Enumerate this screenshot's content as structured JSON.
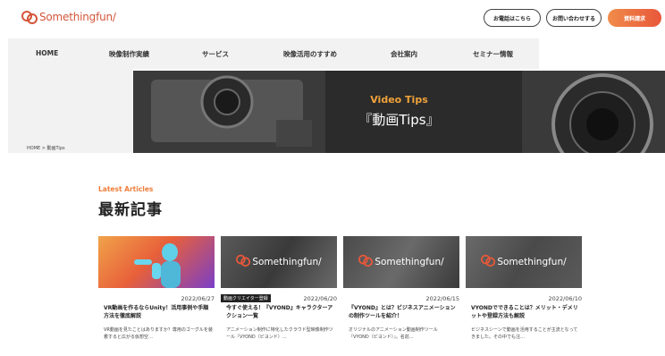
{
  "colors": {
    "brand": "#d4553b",
    "accent": "#ef7d3a",
    "nav_bg": "#f2f2f2"
  },
  "header": {
    "logo_text": "Somethingfun/",
    "logo_icon": "dual-circle-logo-icon",
    "buttons": {
      "phone": "お電話はこちら",
      "contact": "お問い合わせする",
      "materials": "資料請求"
    }
  },
  "nav": {
    "items": [
      "HOME",
      "映像制作実績",
      "サービス",
      "映像活用のすすめ",
      "会社案内",
      "セミナー情報"
    ]
  },
  "hero": {
    "eyebrow": "Video Tips",
    "title": "『動画Tips』"
  },
  "breadcrumb": "HOME > 動画Tips",
  "section": {
    "eyebrow": "Latest Articles",
    "title": "最新記事"
  },
  "cards": [
    {
      "date": "2022/06/27",
      "badge": "",
      "title": "VR動画を作るならUnity！活用事例や手順方法を徹底解説",
      "excerpt": "VR動画を見たことはありますか？専用のゴーグルを装着すると広がる仮想空…",
      "thumb_text": ""
    },
    {
      "date": "2022/06/20",
      "badge": "動画クリエイター登録",
      "title": "今すぐ使える！『VYOND』キャラクターアクション一覧",
      "excerpt": "アニメーション制作に特化したクラウド型映像制作ツール『VYOND（ビヨンド）…",
      "thumb_text": "Somethingfun/"
    },
    {
      "date": "2022/06/15",
      "badge": "",
      "title": "『VYOND』とは？ビジネスアニメーションの制作ツールを紹介！",
      "excerpt": "オリジナルのアニメーション動画制作ツール『VYOND（ビヨンド）』。名前…",
      "thumb_text": "Somethingfun/"
    },
    {
      "date": "2022/06/10",
      "badge": "",
      "title": "VYONDでできることは？メリット・デメリットや登録方法も解説",
      "excerpt": "ビジネスシーンで動画を活用することが主流となってきました。その中でも注…",
      "thumb_text": "Somethingfun/"
    }
  ]
}
